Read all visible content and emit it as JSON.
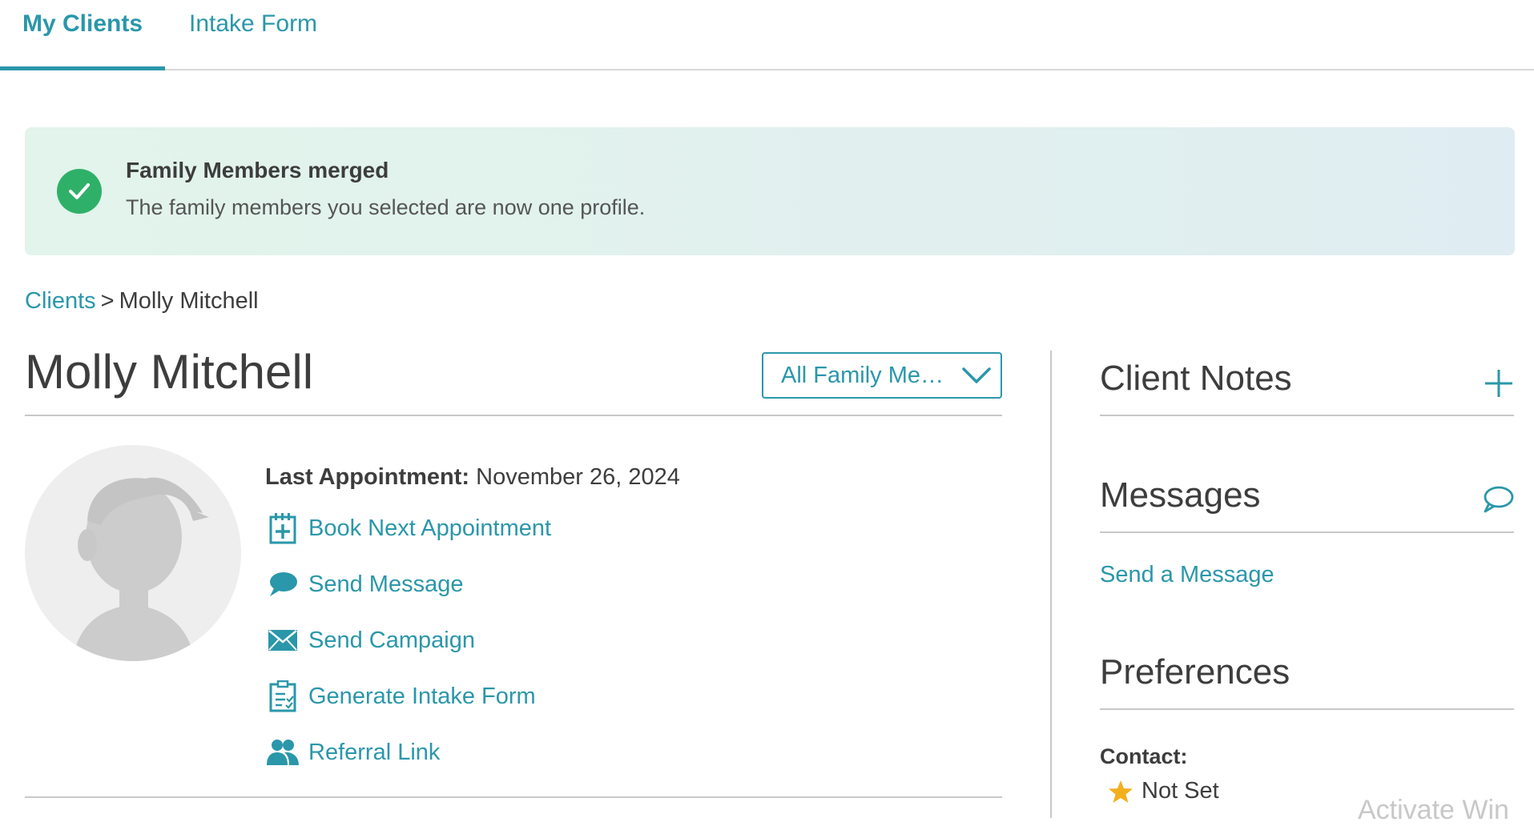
{
  "tabs": {
    "my_clients": "My Clients",
    "intake_form": "Intake Form"
  },
  "alert": {
    "title": "Family Members merged",
    "message": "The family members you selected are now one profile."
  },
  "breadcrumb": {
    "parent": "Clients",
    "separator": ">",
    "current": "Molly Mitchell"
  },
  "client": {
    "name": "Molly Mitchell",
    "family_select": "All Family Me…",
    "last_appointment_label": "Last Appointment:",
    "last_appointment_value": "November 26, 2024"
  },
  "actions": {
    "book": "Book Next Appointment",
    "message": "Send Message",
    "campaign": "Send Campaign",
    "intake": "Generate Intake Form",
    "referral": "Referral Link"
  },
  "sidebar": {
    "notes_title": "Client Notes",
    "messages_title": "Messages",
    "send_message_link": "Send a Message",
    "preferences_title": "Preferences",
    "contact_label": "Contact:",
    "contact_value": "Not Set"
  },
  "watermark": "Activate Win",
  "colors": {
    "accent": "#2a97aa",
    "success": "#2fb068",
    "star": "#f2b01e",
    "text": "#3d3d3d"
  },
  "icons": {
    "alert": "check-circle-icon",
    "book": "calendar-plus-icon",
    "message": "speech-bubble-icon",
    "campaign": "envelope-icon",
    "intake": "clipboard-checklist-icon",
    "referral": "people-icon",
    "notes_add": "plus-icon",
    "messages": "chat-bubble-outline-icon",
    "contact": "star-icon"
  }
}
